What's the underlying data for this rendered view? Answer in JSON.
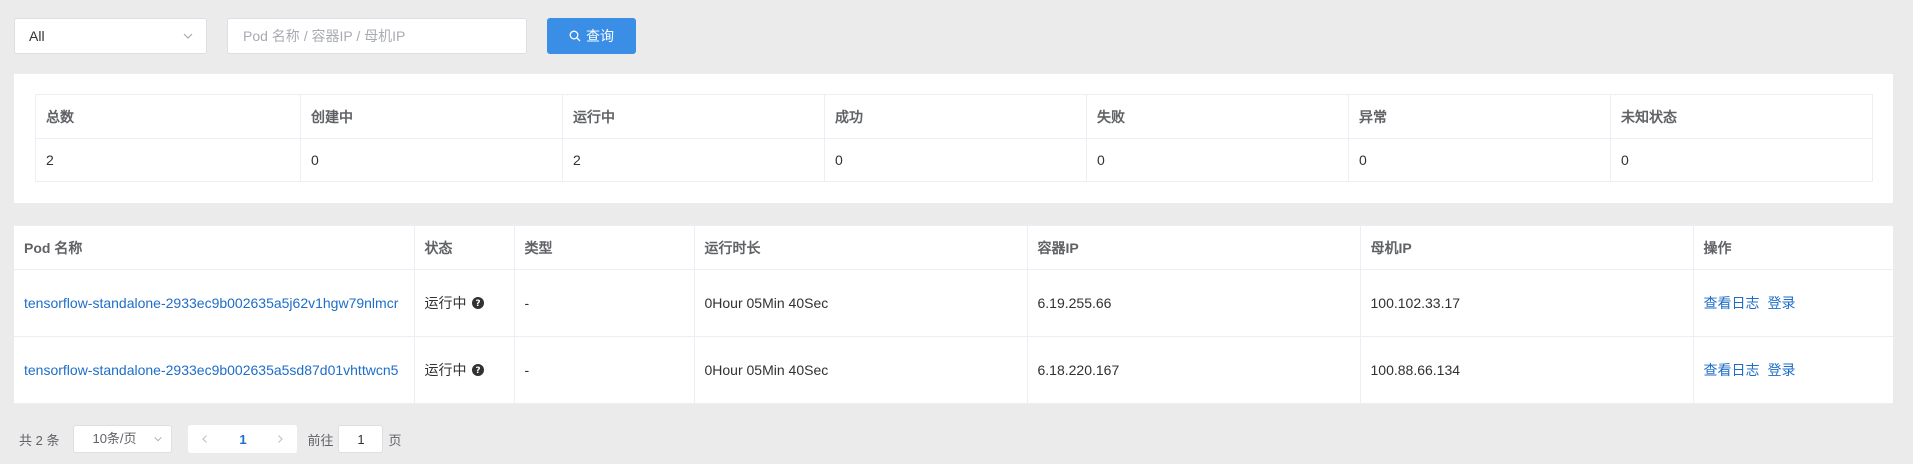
{
  "filter": {
    "selected": "All",
    "placeholder": "Pod 名称 / 容器IP / 母机IP",
    "value": "",
    "query_label": "查询"
  },
  "stats": {
    "headers": [
      "总数",
      "创建中",
      "运行中",
      "成功",
      "失败",
      "异常",
      "未知状态"
    ],
    "values": [
      "2",
      "0",
      "2",
      "0",
      "0",
      "0",
      "0"
    ]
  },
  "pods": {
    "headers": [
      "Pod 名称",
      "状态",
      "类型",
      "运行时长",
      "容器IP",
      "母机IP",
      "操作"
    ],
    "rows": [
      {
        "name": "tensorflow-standalone-2933ec9b002635a5j62v1hgw79nlmcr",
        "status": "运行中",
        "type": "-",
        "duration": "0Hour 05Min 40Sec",
        "container_ip": "6.19.255.66",
        "host_ip": "100.102.33.17",
        "log_label": "查看日志",
        "login_label": "登录"
      },
      {
        "name": "tensorflow-standalone-2933ec9b002635a5sd87d01vhttwcn5",
        "status": "运行中",
        "type": "-",
        "duration": "0Hour 05Min 40Sec",
        "container_ip": "6.18.220.167",
        "host_ip": "100.88.66.134",
        "log_label": "查看日志",
        "login_label": "登录"
      }
    ]
  },
  "pagination": {
    "total_text": "共 2 条",
    "page_size": "10条/页",
    "current_page": "1",
    "goto_prefix": "前往",
    "goto_value": "1",
    "goto_suffix": "页"
  },
  "colors": {
    "primary": "#3a8ee6",
    "link": "#1e6dc8",
    "background": "#ebebeb"
  },
  "icons": {
    "query": "search-icon",
    "select": "chevron-down-icon",
    "status_help": "question-circle-icon"
  }
}
